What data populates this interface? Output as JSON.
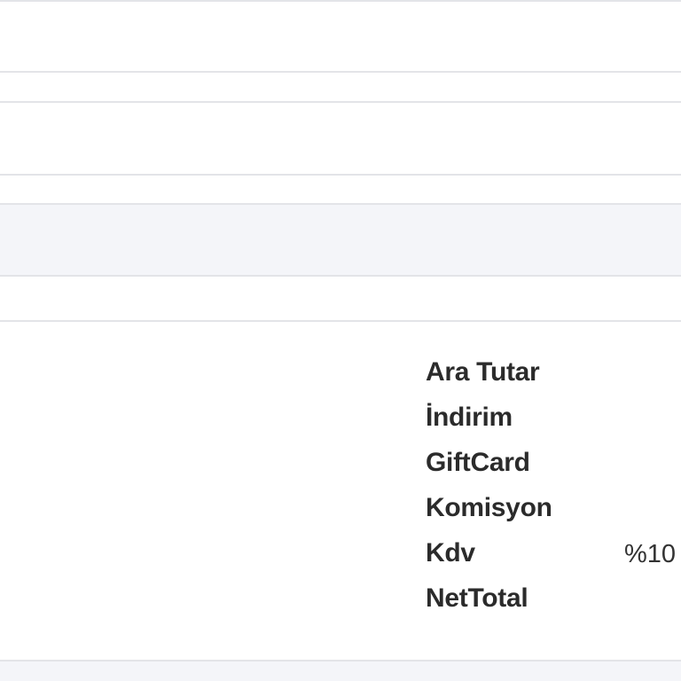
{
  "summary": {
    "rows": [
      {
        "label": "Ara Tutar",
        "value": ""
      },
      {
        "label": "İndirim",
        "value": ""
      },
      {
        "label": "GiftCard",
        "value": ""
      },
      {
        "label": "Komisyon",
        "value": ""
      },
      {
        "label": "Kdv",
        "value": "%10"
      },
      {
        "label": "NetTotal",
        "value": ""
      }
    ]
  }
}
